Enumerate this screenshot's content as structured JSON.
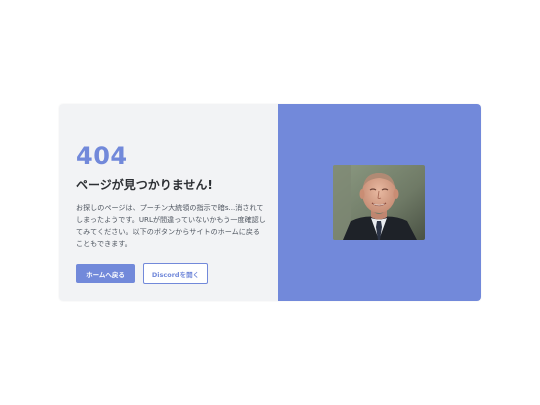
{
  "error": {
    "code": "404",
    "title": "ページが見つかりません!",
    "description": "お探しのページは、プーチン大統領の指示で暗s...消されてしまったようです。URLが間違っていないかもう一度確認してみてください。以下のボタンからサイトのホームに戻ることもできます。"
  },
  "buttons": {
    "home_label": "ホームへ戻る",
    "discord_label": "Discordを開く"
  },
  "image": {
    "subject": "man-in-suit-photo"
  },
  "colors": {
    "accent": "#7289da",
    "panel_bg": "#f2f3f5",
    "title_text": "#2c2f33",
    "body_text": "#4f5660"
  }
}
